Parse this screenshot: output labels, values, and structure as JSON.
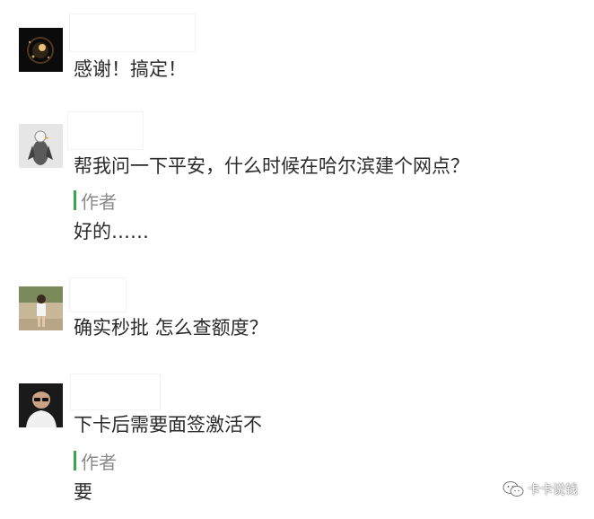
{
  "comments": [
    {
      "avatar": "dark-sparkle-avatar",
      "text": "感谢！搞定！"
    },
    {
      "avatar": "eagle-avatar",
      "text": "帮我问一下平安，什么时候在哈尔滨建个网点？",
      "reply": {
        "label": "作者",
        "text": "好的……"
      }
    },
    {
      "avatar": "outdoor-person-avatar",
      "text": "确实秒批 怎么查额度？"
    },
    {
      "avatar": "sunglasses-man-avatar",
      "text": "下卡后需要面签激活不",
      "reply": {
        "label": "作者",
        "text": "要"
      }
    }
  ],
  "watermark": {
    "icon": "wechat-icon",
    "text": "卡卡说钱"
  },
  "colors": {
    "author_bar": "#3aa64a",
    "author_label": "#8a8a8a",
    "text": "#2b2b2b"
  }
}
